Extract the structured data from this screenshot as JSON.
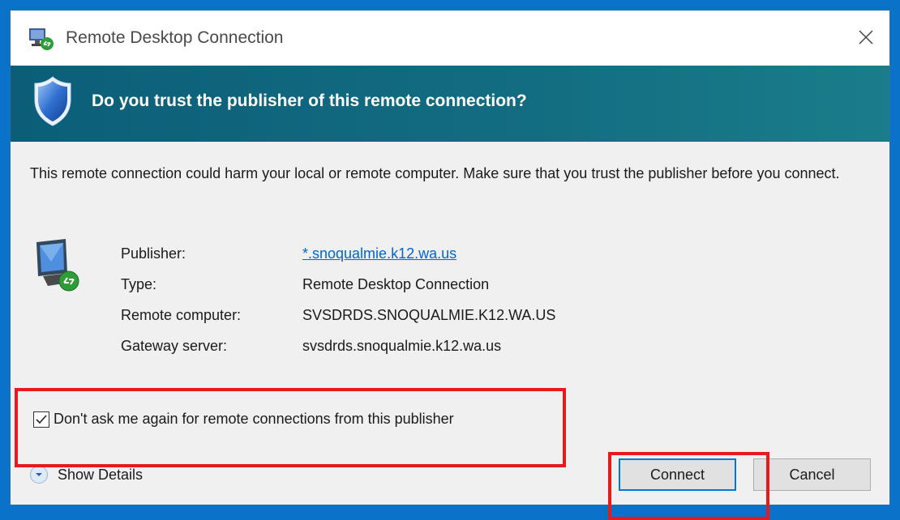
{
  "window": {
    "title": "Remote Desktop Connection",
    "close_glyph": "✕"
  },
  "banner": {
    "question": "Do you trust the publisher of this remote connection?",
    "icon": "shield-icon",
    "color": "#0c5e78"
  },
  "intro_text": "This remote connection could harm your local or remote computer. Make sure that you trust the publisher before you connect.",
  "details": [
    {
      "label": "Publisher:",
      "value": "*.snoqualmie.k12.wa.us",
      "is_link": true
    },
    {
      "label": "Type:",
      "value": "Remote Desktop Connection",
      "is_link": false
    },
    {
      "label": "Remote computer:",
      "value": "SVSDRDS.SNOQUALMIE.K12.WA.US",
      "is_link": false
    },
    {
      "label": "Gateway server:",
      "value": "svsdrds.snoqualmie.k12.wa.us",
      "is_link": false
    }
  ],
  "dont_ask_checkbox": {
    "label": "Don't ask me again for remote connections from this publisher",
    "checked": true
  },
  "show_details_label": "Show Details",
  "buttons": {
    "connect": "Connect",
    "cancel": "Cancel"
  },
  "colors": {
    "highlight": "#e8191c",
    "link": "#0066cc",
    "desktop_background": "#0a73c9"
  }
}
